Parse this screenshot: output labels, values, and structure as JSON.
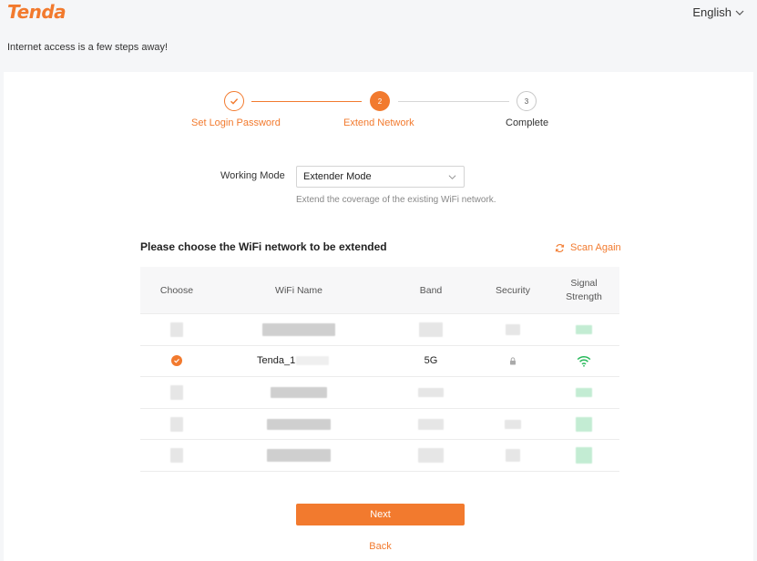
{
  "brand": {
    "logo_text": "Tenda",
    "accent": "#f27a2e"
  },
  "header": {
    "language": "English",
    "tagline": "Internet access is a few steps away!"
  },
  "stepper": {
    "steps": [
      {
        "label": "Set Login Password",
        "state": "done",
        "marker": ""
      },
      {
        "label": "Extend Network",
        "state": "active",
        "marker": "2"
      },
      {
        "label": "Complete",
        "state": "todo",
        "marker": "3"
      }
    ]
  },
  "form": {
    "working_mode_label": "Working Mode",
    "working_mode_value": "Extender Mode",
    "working_mode_desc": "Extend the coverage of the existing WiFi network."
  },
  "network": {
    "title": "Please choose the WiFi network to be extended",
    "scan_label": "Scan Again",
    "columns": [
      "Choose",
      "WiFi Name",
      "Band",
      "Security",
      "Signal\nStrength"
    ],
    "selected_row": {
      "wifi_name": "Tenda_1",
      "band": "5G",
      "security_icon": "lock-icon",
      "signal_icon": "wifi-signal-icon"
    }
  },
  "actions": {
    "next_label": "Next",
    "back_label": "Back"
  }
}
